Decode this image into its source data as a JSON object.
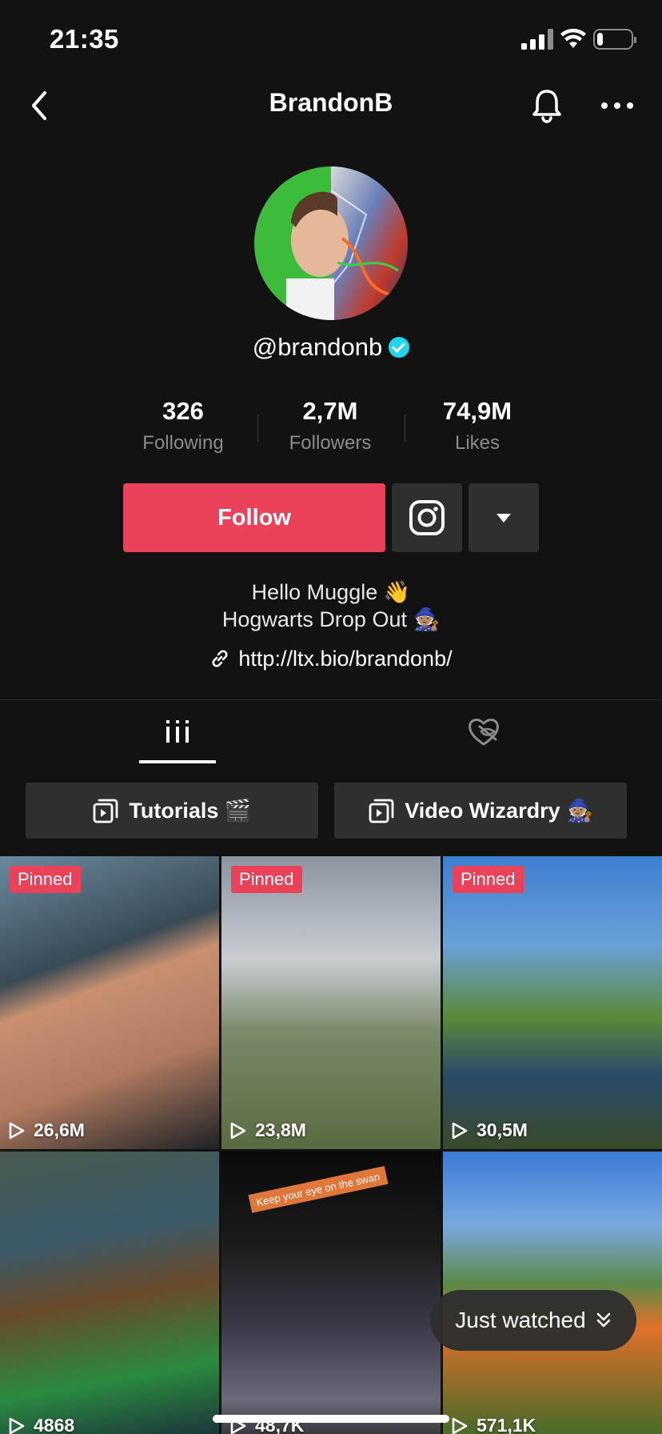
{
  "status_bar": {
    "time": "21:35",
    "battery_level": 0.18
  },
  "header": {
    "title": "BrandonB",
    "icons": [
      "back-icon",
      "bell-icon",
      "more-icon"
    ]
  },
  "profile": {
    "handle": "@brandonb",
    "verified": true,
    "stats": [
      {
        "value": "326",
        "label": "Following"
      },
      {
        "value": "2,7M",
        "label": "Followers"
      },
      {
        "value": "74,9M",
        "label": "Likes"
      }
    ],
    "follow_label": "Follow",
    "bio_lines": [
      "Hello Muggle 👋",
      "Hogwarts Drop Out 🧙🏽"
    ],
    "link": "http://ltx.bio/brandonb/"
  },
  "tabs": [
    "videos-grid-icon",
    "liked-private-icon"
  ],
  "playlists": [
    {
      "label": "Tutorials 🎬"
    },
    {
      "label": "Video Wizardry 🧙🏽"
    }
  ],
  "videos": [
    {
      "pinned": "Pinned",
      "views": "26,6M"
    },
    {
      "pinned": "Pinned",
      "views": "23,8M"
    },
    {
      "pinned": "Pinned",
      "views": "30,5M"
    },
    {
      "pinned": "",
      "views": "4868"
    },
    {
      "pinned": "",
      "views": "48,7K",
      "caption": "Keep your eye on the swan"
    },
    {
      "pinned": "",
      "views": "571,1K"
    }
  ],
  "just_watched": "Just watched",
  "colors": {
    "accent": "#ea4359",
    "background": "#121212",
    "button": "#2f2f2f",
    "verified": "#20d5ec"
  }
}
